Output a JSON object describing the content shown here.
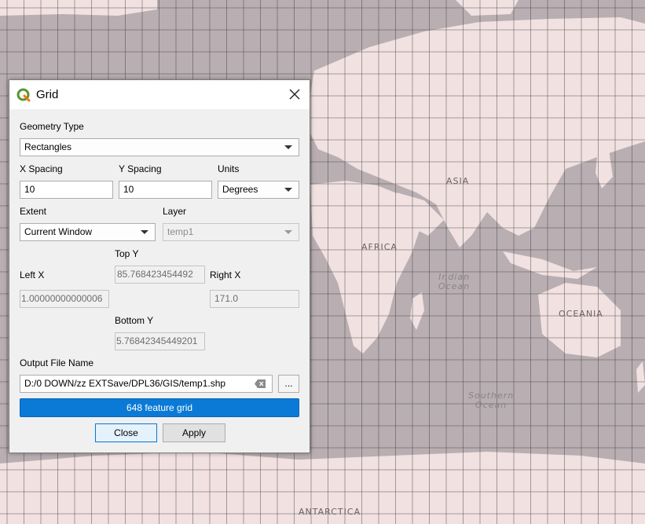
{
  "dialog": {
    "title": "Grid",
    "geometry_type_label": "Geometry Type",
    "geometry_type_value": "Rectangles",
    "x_spacing_label": "X Spacing",
    "x_spacing_value": "10",
    "y_spacing_label": "Y Spacing",
    "y_spacing_value": "10",
    "units_label": "Units",
    "units_value": "Degrees",
    "extent_label": "Extent",
    "extent_value": "Current Window",
    "layer_label": "Layer",
    "layer_value": "temp1",
    "top_y_label": "Top Y",
    "top_y_value": "85.768423454492",
    "left_x_label": "Left X",
    "left_x_value": "1.00000000000006",
    "right_x_label": "Right X",
    "right_x_value": "171.0",
    "bottom_y_label": "Bottom Y",
    "bottom_y_value": "5.76842345449201",
    "output_label": "Output File Name",
    "output_value": "D:/0 DOWN/zz EXTSave/DPL36/GIS/temp1.shp",
    "browse_label": "...",
    "progress_text": "648 feature grid",
    "progress_value": 1.0,
    "close_label": "Close",
    "apply_label": "Apply"
  },
  "map": {
    "labels": {
      "asia": "ASIA",
      "africa": "AFRICA",
      "oceania": "OCEANIA",
      "antarctica": "ANTARCTICA",
      "indian_ocean_1": "Indian",
      "indian_ocean_2": "Ocean",
      "southern_ocean_1": "Southern",
      "southern_ocean_2": "Ocean"
    },
    "colors": {
      "land": "#f1e1e1",
      "water": "#b9aeb2",
      "grid": "#3a3a3a"
    }
  },
  "icons": {
    "logo": "qgis-logo-icon",
    "close": "close-icon",
    "dropdown": "chevron-down-icon",
    "clear": "clear-field-icon"
  }
}
